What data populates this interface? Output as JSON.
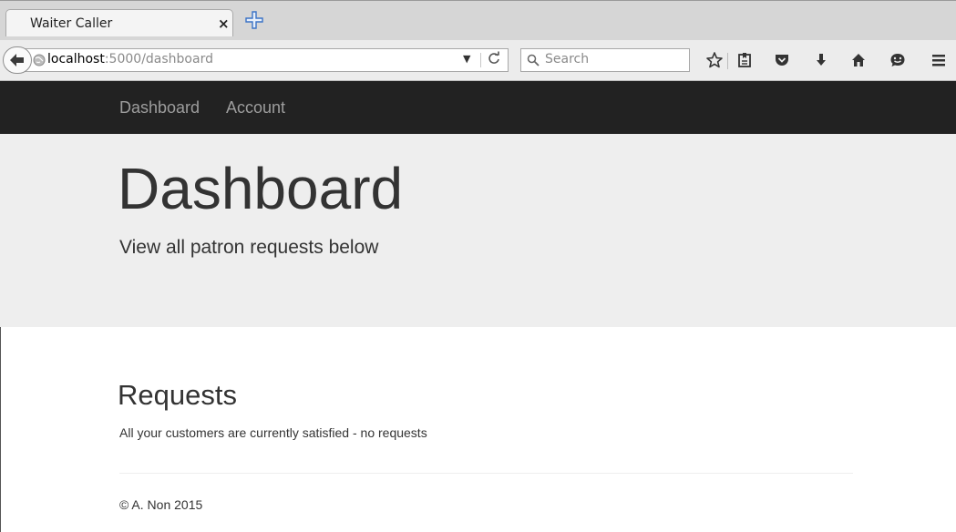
{
  "browser": {
    "tab_title": "Waiter Caller",
    "tab_close": "×",
    "url_host": "localhost",
    "url_path": ":5000/dashboard",
    "search_placeholder": "Search"
  },
  "nav": {
    "links": [
      "Dashboard",
      "Account"
    ]
  },
  "jumbotron": {
    "title": "Dashboard",
    "subtitle": "View all patron requests below"
  },
  "requests": {
    "title": "Requests",
    "message": "All your customers are currently satisfied - no requests"
  },
  "footer": {
    "text": "© A. Non 2015"
  }
}
